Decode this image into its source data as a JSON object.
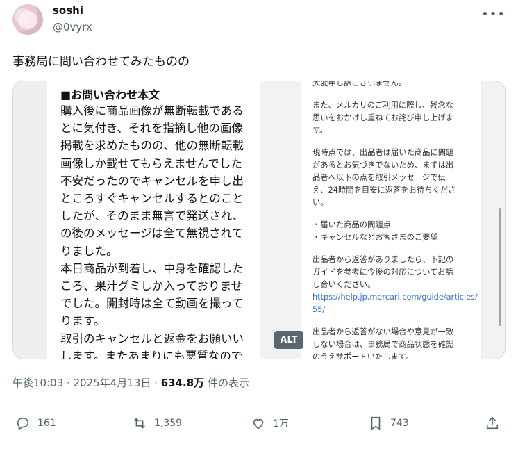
{
  "post": {
    "user": {
      "name": "soshi",
      "handle": "@0vyrx"
    },
    "text": "事務局に問い合わせてみたものの",
    "media": {
      "left": {
        "heading": "■お問い合わせ本文",
        "body": "購入後に商品画像が無断転載である\nとに気付き、それを指摘し他の画像\n掲載を求めたものの、他の無断転載\n画像しか載せてもらえませんでした\n不安だったのでキャンセルを申し出\nところすぐキャンセルするとのこと\nしたが、そのまま無言で発送され、\nの後のメッセージは全て無視されて\nりました。\n本日商品が到着し、中身を確認した\nころ、果汁グミしか入っておりませ\nでした。開封時は全て動画を撮って\nります。\n取引のキャンセルと返金をお願いい\nします。またあまりにも悪質なので"
      },
      "right": {
        "p1": "大変申し訳ございません。",
        "p2": "また、メルカリのご利用に際し、残念な\n思いをおかけし重ねてお詫び申し上げま\nす。",
        "p3": "現時点では、出品者は届いた商品に問題\nがあるとお気づきでないため、まずは出\n品者へ以下の点を取引メッセージで伝\nえ、24時間を目安に返答をお待ちくださ\nい。",
        "p4": "・届いた商品の問題点\n・キャンセルなどお客さまのご要望",
        "p5": "出品者から返答がありましたら、下記の\nガイドを参考に今後の対応についてお話\nし合いください。",
        "link": "https://help.jp.mercari.com/guide/articles/55/",
        "p6": "出品者から返答がない場合や意見が一致\nしない場合は、事務局で商品状態を確認\nのうえサポートいたします。"
      },
      "alt_badge": "ALT"
    },
    "meta": {
      "time": "午後10:03",
      "date": "2025年4月13日",
      "views_value": "634.8万",
      "views_suffix": "件の表示"
    },
    "actions": {
      "replies": "161",
      "reposts": "1,359",
      "likes": "1万",
      "bookmarks": "743"
    }
  }
}
